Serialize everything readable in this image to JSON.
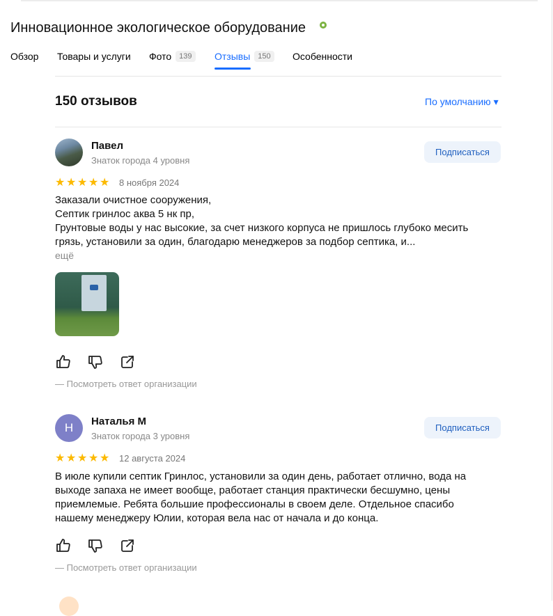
{
  "org": {
    "title": "Инновационное экологическое оборудование"
  },
  "tabs": [
    {
      "label": "Обзор"
    },
    {
      "label": "Товары и услуги"
    },
    {
      "label": "Фото",
      "count": "139"
    },
    {
      "label": "Отзывы",
      "count": "150"
    },
    {
      "label": "Особенности"
    }
  ],
  "active_tab": "Отзывы",
  "reviews_header": {
    "title": "150 отзывов",
    "sort": "По умолчанию ▾"
  },
  "reviews": [
    {
      "author": "Павел",
      "level": "Знаток города 4 уровня",
      "subscribe": "Подписаться",
      "rating": 5,
      "date": "8 ноября 2024",
      "text_lines": [
        "Заказали очистное сооружения,",
        "Септик гринлос аква 5 нк пр,",
        "Грунтовые воды у нас высокие, за счет низкого корпуса не пришлось глубоко месить",
        "грязь, установили за один, благодарю менеджеров за подбор септика, и..."
      ],
      "more": "ещё",
      "has_photo": true,
      "answer": "— Посмотреть ответ организации"
    },
    {
      "author": "Наталья М",
      "avatar_letter": "Н",
      "level": "Знаток города 3 уровня",
      "subscribe": "Подписаться",
      "rating": 5,
      "date": "12 августа 2024",
      "text_lines": [
        "В июле купили септик Гринлос, установили за один день, работает отлично, вода на",
        "выходе запаха не имеет вообще, работает станция практически бесшумно, цены",
        "приемлемые. Ребята большие профессионалы в своем деле. Отдельное спасибо",
        "нашему менеджеру Юлии, которая вела нас от начала и до конца."
      ],
      "answer": "— Посмотреть ответ организации"
    }
  ],
  "colors": {
    "accent": "#196dff",
    "star": "#fcb900",
    "verified": "#7cb342",
    "avatar_letter_bg": "#7e80c8"
  },
  "icons": [
    "verified-icon",
    "thumbs-up-icon",
    "thumbs-down-icon",
    "share-icon",
    "star-icon"
  ]
}
